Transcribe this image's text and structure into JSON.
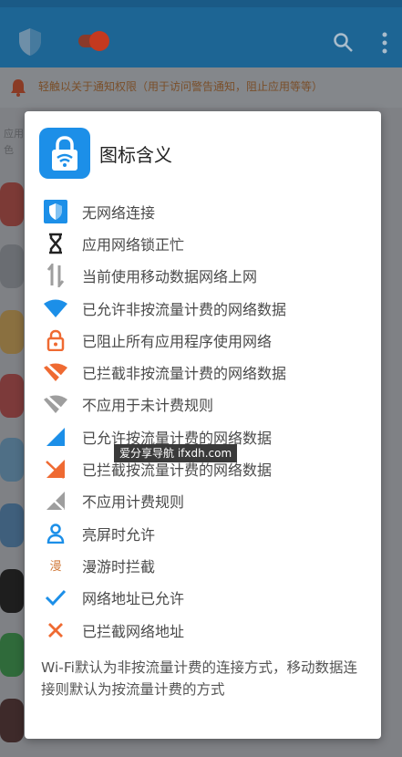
{
  "background": {
    "notice_text": "轻触以关于通知权限（用于访问警告通知，阻止应用等等）",
    "side_text_1": "应用",
    "side_text_2": "色"
  },
  "dialog": {
    "title": "图标含义",
    "items": [
      {
        "icon": "shield-icon",
        "label": "无网络连接"
      },
      {
        "icon": "hourglass-icon",
        "label": "应用网络锁正忙"
      },
      {
        "icon": "mobile-data-arrows-icon",
        "label": "当前使用移动数据网络上网"
      },
      {
        "icon": "wifi-allowed-icon",
        "label": "已允许非按流量计费的网络数据"
      },
      {
        "icon": "lock-icon",
        "label": "已阻止所有应用程序使用网络"
      },
      {
        "icon": "wifi-blocked-icon",
        "label": "已拦截非按流量计费的网络数据"
      },
      {
        "icon": "wifi-not-applicable-icon",
        "label": "不应用于未计费规则"
      },
      {
        "icon": "cellular-allowed-icon",
        "label": "已允许按流量计费的网络数据"
      },
      {
        "icon": "cellular-blocked-icon",
        "label": "已拦截按流量计费的网络数据"
      },
      {
        "icon": "cellular-not-applicable-icon",
        "label": "不应用计费规则"
      },
      {
        "icon": "person-icon",
        "label": "亮屏时允许"
      },
      {
        "icon": "roaming-icon",
        "label": "漫游时拦截",
        "glyph": "漫"
      },
      {
        "icon": "checkmark-icon",
        "label": "网络地址已允许"
      },
      {
        "icon": "cross-icon",
        "label": "已拦截网络地址"
      }
    ],
    "footnote": "Wi-Fi默认为非按流量计费的连接方式，移动数据连接则默认为按流量计费的方式"
  },
  "watermark": "爱分享导航 ifxdh.com",
  "colors": {
    "blue": "#1c8fe8",
    "orange": "#ef6a32",
    "gray": "#9e9e9e",
    "dark": "#222222"
  }
}
